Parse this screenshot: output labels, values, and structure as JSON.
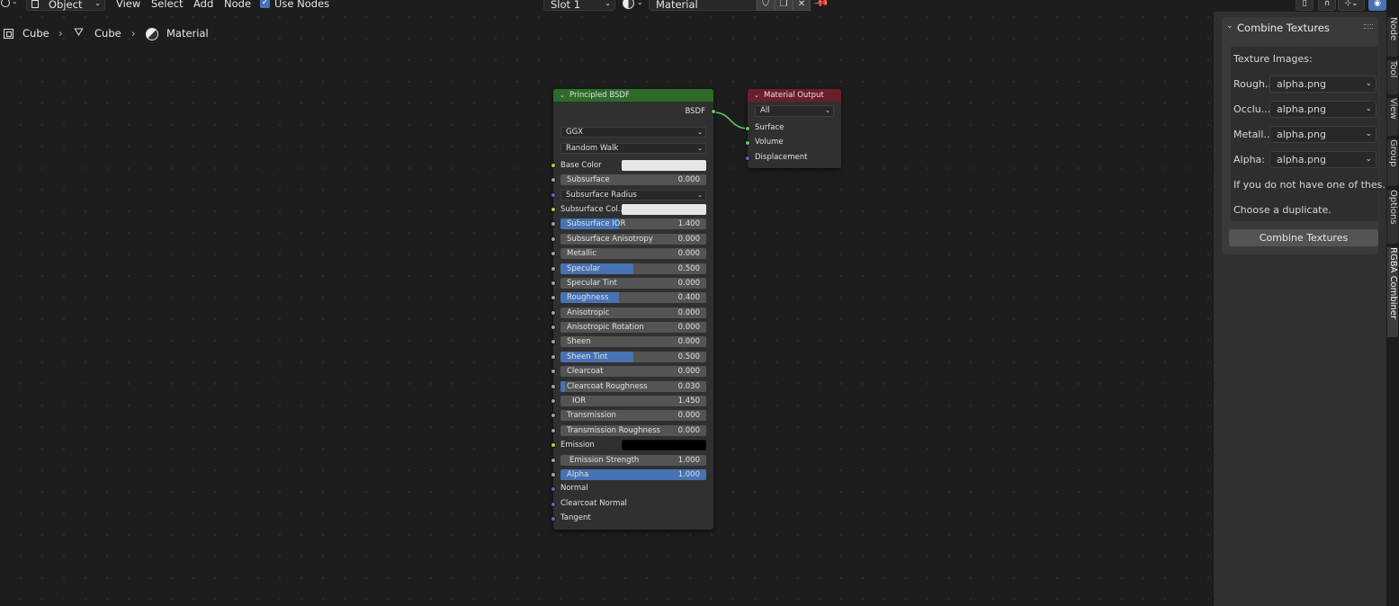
{
  "header": {
    "mode": "Object",
    "menus": [
      "View",
      "Select",
      "Add",
      "Node"
    ],
    "use_nodes_label": "Use Nodes",
    "slot": "Slot 1",
    "material_name": "Material"
  },
  "breadcrumb": {
    "object": "Cube",
    "mesh": "Cube",
    "material": "Material",
    "sep": "›"
  },
  "bsdf_node": {
    "title": "Principled BSDF",
    "output": "BSDF",
    "distribution": "GGX",
    "subsurface_method": "Random Walk",
    "base_color_label": "Base Color",
    "base_color": "#e6e6e6",
    "subsurface": {
      "label": "Subsurface",
      "value": "0.000",
      "fraction": 0
    },
    "subsurface_radius": "Subsurface Radius",
    "subsurface_color_label": "Subsurface Col..",
    "subsurface_color": "#e6e6e6",
    "sliders": [
      {
        "label": "Subsurface IOR",
        "value": "1.400",
        "fraction": 0.4
      },
      {
        "label": "Subsurface Anisotropy",
        "value": "0.000",
        "fraction": 0
      },
      {
        "label": "Metallic",
        "value": "0.000",
        "fraction": 0
      },
      {
        "label": "Specular",
        "value": "0.500",
        "fraction": 0.5
      },
      {
        "label": "Specular Tint",
        "value": "0.000",
        "fraction": 0
      },
      {
        "label": "Roughness",
        "value": "0.400",
        "fraction": 0.4
      },
      {
        "label": "Anisotropic",
        "value": "0.000",
        "fraction": 0
      },
      {
        "label": "Anisotropic Rotation",
        "value": "0.000",
        "fraction": 0
      },
      {
        "label": "Sheen",
        "value": "0.000",
        "fraction": 0
      },
      {
        "label": "Sheen Tint",
        "value": "0.500",
        "fraction": 0.5
      },
      {
        "label": "Clearcoat",
        "value": "0.000",
        "fraction": 0
      },
      {
        "label": "Clearcoat Roughness",
        "value": "0.030",
        "fraction": 0.03
      },
      {
        "label": "IOR",
        "value": "1.450",
        "fraction": 0
      },
      {
        "label": "Transmission",
        "value": "0.000",
        "fraction": 0
      },
      {
        "label": "Transmission Roughness",
        "value": "0.000",
        "fraction": 0
      }
    ],
    "emission_label": "Emission",
    "emission_color": "#000000",
    "emission_strength": {
      "label": "Emission Strength",
      "value": "1.000",
      "fraction": 0
    },
    "alpha": {
      "label": "Alpha",
      "value": "1.000",
      "fraction": 1
    },
    "normal": "Normal",
    "clearcoat_normal": "Clearcoat Normal",
    "tangent": "Tangent"
  },
  "output_node": {
    "title": "Material Output",
    "target": "All",
    "inputs": [
      "Surface",
      "Volume",
      "Displacement"
    ]
  },
  "sidebar": {
    "panel_title": "Combine Textures",
    "texture_images_label": "Texture Images:",
    "rows": [
      {
        "label": "Rough...",
        "value": "alpha.png"
      },
      {
        "label": "Occlu...",
        "value": "alpha.png"
      },
      {
        "label": "Metall...",
        "value": "alpha.png"
      },
      {
        "label": "Alpha:",
        "value": "alpha.png"
      }
    ],
    "info1": "If you do not have one of thes...",
    "info2": "Choose a duplicate.",
    "button": "Combine Textures",
    "tabs": [
      "Node",
      "Tool",
      "View",
      "Group",
      "Options",
      "RGBA Combiner"
    ]
  },
  "colors": {
    "accent": "#4772b3",
    "bsdf_header": "#2e6b2b",
    "output_header": "#6b1f2b",
    "link": "#63c763"
  }
}
